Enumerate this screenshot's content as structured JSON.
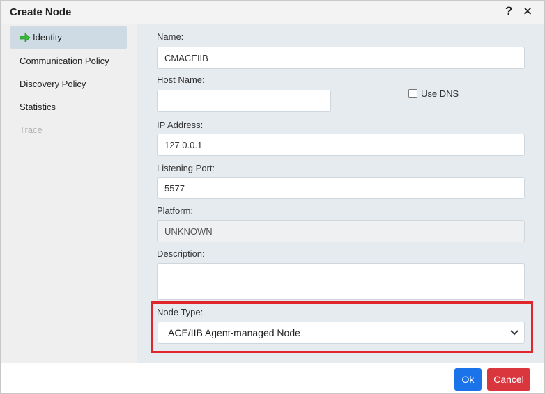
{
  "dialog": {
    "title": "Create Node",
    "help_glyph": "?",
    "close_glyph": "✕"
  },
  "sidebar": {
    "items": [
      {
        "label": "Identity",
        "state": "active",
        "icon": "green-arrow-icon"
      },
      {
        "label": "Communication Policy",
        "state": "normal"
      },
      {
        "label": "Discovery Policy",
        "state": "normal"
      },
      {
        "label": "Statistics",
        "state": "normal"
      },
      {
        "label": "Trace",
        "state": "disabled"
      }
    ]
  },
  "form": {
    "name_label": "Name:",
    "name_value": "CMACEIIB",
    "host_label": "Host Name:",
    "host_value": "",
    "use_dns_label": "Use DNS",
    "use_dns_checked": false,
    "ip_label": "IP Address:",
    "ip_value": "127.0.0.1",
    "port_label": "Listening Port:",
    "port_value": "5577",
    "platform_label": "Platform:",
    "platform_value": "UNKNOWN",
    "description_label": "Description:",
    "description_value": "",
    "node_type_label": "Node Type:",
    "node_type_value": "ACE/IIB Agent-managed Node"
  },
  "footer": {
    "ok_label": "Ok",
    "cancel_label": "Cancel"
  },
  "colors": {
    "primary": "#1a73e8",
    "danger": "#d9363e",
    "highlight": "#e0252b",
    "arrow": "#3cb93c"
  }
}
